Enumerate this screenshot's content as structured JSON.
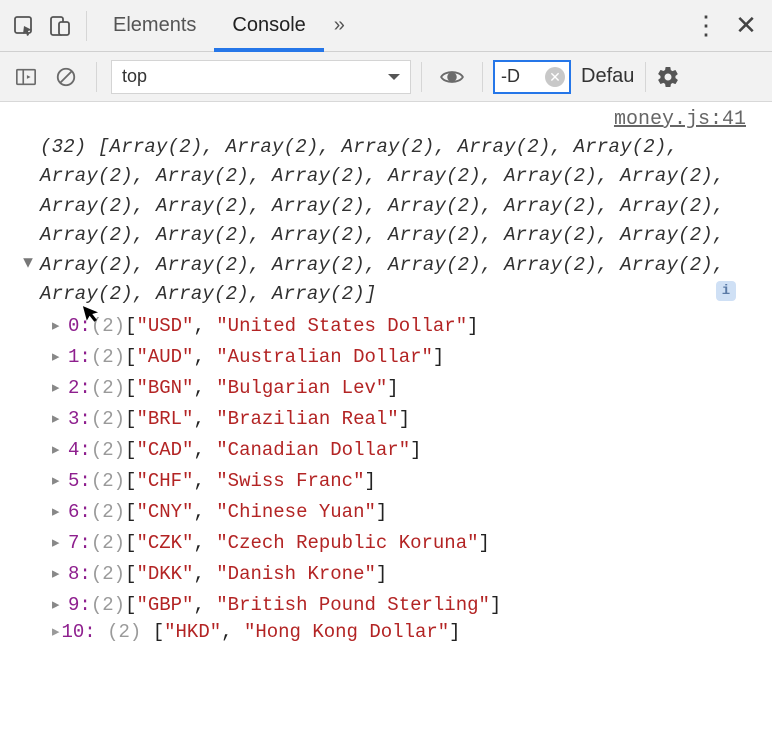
{
  "tabs": {
    "elements": "Elements",
    "console": "Console",
    "more": "»"
  },
  "toolbar": {
    "context": "top",
    "filter_value": "-D",
    "levels_label": "Default levels"
  },
  "source_link": "money.js:41",
  "log": {
    "count": 32,
    "item_label": "Array(2)",
    "preview_text": "(32) [Array(2), Array(2), Array(2), Array(2), Array(2), Array(2), Array(2), Array(2), Array(2), Array(2), Array(2), Array(2), Array(2), Array(2), Array(2), Array(2), Array(2), Array(2), Array(2), Array(2), Array(2), Array(2), Array(2), Array(2), Array(2), Array(2), Array(2), Array(2), Array(2), Array(2), Array(2), Array(2)]"
  },
  "entries": [
    {
      "idx": 0,
      "len": 2,
      "v": [
        "USD",
        "United States Dollar"
      ]
    },
    {
      "idx": 1,
      "len": 2,
      "v": [
        "AUD",
        "Australian Dollar"
      ]
    },
    {
      "idx": 2,
      "len": 2,
      "v": [
        "BGN",
        "Bulgarian Lev"
      ]
    },
    {
      "idx": 3,
      "len": 2,
      "v": [
        "BRL",
        "Brazilian Real"
      ]
    },
    {
      "idx": 4,
      "len": 2,
      "v": [
        "CAD",
        "Canadian Dollar"
      ]
    },
    {
      "idx": 5,
      "len": 2,
      "v": [
        "CHF",
        "Swiss Franc"
      ]
    },
    {
      "idx": 6,
      "len": 2,
      "v": [
        "CNY",
        "Chinese Yuan"
      ]
    },
    {
      "idx": 7,
      "len": 2,
      "v": [
        "CZK",
        "Czech Republic Koruna"
      ]
    },
    {
      "idx": 8,
      "len": 2,
      "v": [
        "DKK",
        "Danish Krone"
      ]
    },
    {
      "idx": 9,
      "len": 2,
      "v": [
        "GBP",
        "British Pound Sterling"
      ]
    },
    {
      "idx": 10,
      "len": 2,
      "v": [
        "HKD",
        "Hong Kong Dollar"
      ]
    }
  ]
}
